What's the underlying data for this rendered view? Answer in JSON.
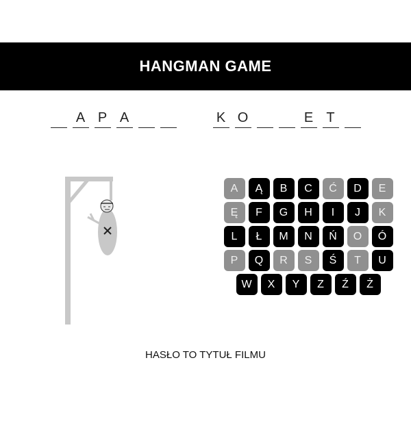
{
  "header": {
    "title": "HANGMAN GAME"
  },
  "puzzle": {
    "words": [
      [
        "",
        "A",
        "P",
        "A",
        "",
        ""
      ],
      [
        "K",
        "O",
        "",
        "",
        "E",
        "T",
        ""
      ]
    ]
  },
  "keyboard": {
    "keys": [
      {
        "letter": "A",
        "used": true
      },
      {
        "letter": "Ą",
        "used": false
      },
      {
        "letter": "B",
        "used": false
      },
      {
        "letter": "C",
        "used": false
      },
      {
        "letter": "Ć",
        "used": true
      },
      {
        "letter": "D",
        "used": false
      },
      {
        "letter": "E",
        "used": true
      },
      {
        "letter": "Ę",
        "used": true
      },
      {
        "letter": "F",
        "used": false
      },
      {
        "letter": "G",
        "used": false
      },
      {
        "letter": "H",
        "used": false
      },
      {
        "letter": "I",
        "used": false
      },
      {
        "letter": "J",
        "used": false
      },
      {
        "letter": "K",
        "used": true
      },
      {
        "letter": "L",
        "used": false
      },
      {
        "letter": "Ł",
        "used": false
      },
      {
        "letter": "M",
        "used": false
      },
      {
        "letter": "N",
        "used": false
      },
      {
        "letter": "Ń",
        "used": false
      },
      {
        "letter": "O",
        "used": true
      },
      {
        "letter": "Ó",
        "used": false
      },
      {
        "letter": "P",
        "used": true
      },
      {
        "letter": "Q",
        "used": false
      },
      {
        "letter": "R",
        "used": true
      },
      {
        "letter": "S",
        "used": true
      },
      {
        "letter": "Ś",
        "used": false
      },
      {
        "letter": "T",
        "used": true
      },
      {
        "letter": "U",
        "used": false
      },
      {
        "letter": "W",
        "used": false
      },
      {
        "letter": "X",
        "used": false
      },
      {
        "letter": "Y",
        "used": false
      },
      {
        "letter": "Z",
        "used": false
      },
      {
        "letter": "Ź",
        "used": false
      },
      {
        "letter": "Ż",
        "used": false
      }
    ]
  },
  "hint": {
    "text": "HASŁO TO TYTUŁ FILMU"
  },
  "colors": {
    "active_key": "#000000",
    "used_key": "#909090",
    "gallows": "#c8c8c8",
    "header_bg": "#000000"
  }
}
